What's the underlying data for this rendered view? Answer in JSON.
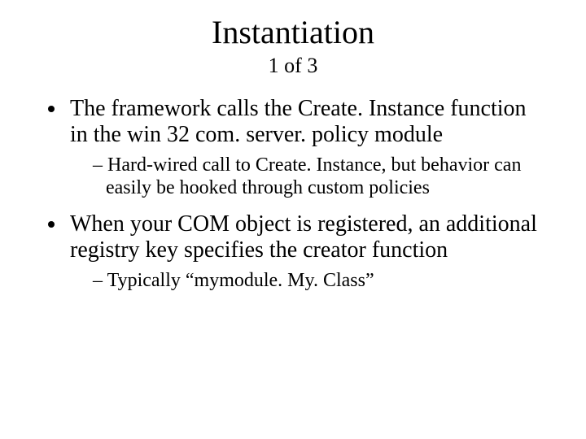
{
  "title": "Instantiation",
  "subtitle": "1 of 3",
  "bullets": {
    "b1": "The framework calls the Create. Instance function in the win 32 com. server. policy module",
    "b1_sub1": "Hard-wired call to Create. Instance, but behavior can easily be hooked through custom policies",
    "b2": "When your COM object is registered, an additional registry key specifies the creator function",
    "b2_sub1": "Typically “mymodule. My. Class”"
  }
}
